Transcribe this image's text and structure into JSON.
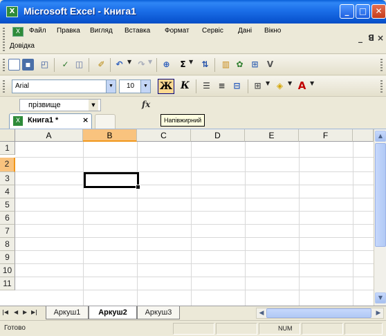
{
  "app": {
    "title": "Microsoft Excel - Книга1",
    "icon": "excel-icon"
  },
  "menu": {
    "items": [
      "Файл",
      "Правка",
      "Вигляд",
      "Вставка",
      "Формат",
      "Сервіс",
      "Дані",
      "Вікно"
    ],
    "help": "Довідка",
    "window_controls": [
      "_",
      "ꓭ",
      "×"
    ]
  },
  "formatting": {
    "font": "Arial",
    "size": "10",
    "bold_label": "Ж",
    "italic_label": "К",
    "bold_tooltip": "Напівжирний"
  },
  "formula_bar": {
    "name_box": "прізвище",
    "fx_label": "fx"
  },
  "workbook_tabs": {
    "active": "Книга1 *",
    "close": "×"
  },
  "grid": {
    "columns": [
      "A",
      "B",
      "C",
      "D",
      "E",
      "F"
    ],
    "rows": [
      "1",
      "2",
      "3",
      "4",
      "5",
      "6",
      "7",
      "8",
      "9",
      "10",
      "11"
    ],
    "selected_column": "B",
    "selected_row": "2"
  },
  "sheets": {
    "tabs": [
      "Аркуш1",
      "Аркуш2",
      "Аркуш3"
    ],
    "active": "Аркуш2"
  },
  "status": {
    "ready": "Готово",
    "num": "NUM"
  }
}
